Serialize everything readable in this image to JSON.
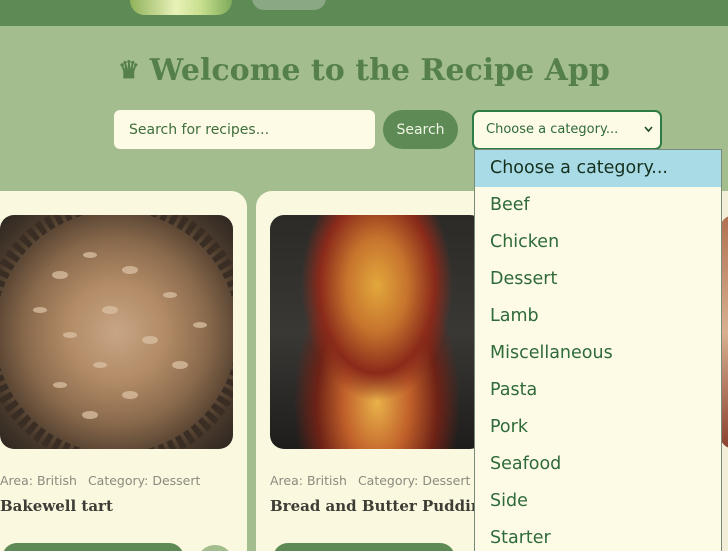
{
  "header": {
    "title": "Welcome to the Recipe App",
    "hat_icon": "♛"
  },
  "search": {
    "placeholder": "Search for recipes...",
    "button_label": "Search"
  },
  "category_select": {
    "selected": "Choose a category...",
    "chevron": "⌵",
    "options": [
      "Choose a category...",
      "Beef",
      "Chicken",
      "Dessert",
      "Lamb",
      "Miscellaneous",
      "Pasta",
      "Pork",
      "Seafood",
      "Side",
      "Starter"
    ]
  },
  "recipes": [
    {
      "area": "Area: British",
      "category": "Category: Dessert",
      "name": "Bakewell tart"
    },
    {
      "area": "Area: British",
      "category": "Category: Dessert",
      "name": "Bread and Butter Pudding"
    }
  ],
  "colors": {
    "background": "#a3bd8e",
    "accent": "#5e8a55",
    "card": "#fbf8e0",
    "selected_option": "#a8dbe6"
  }
}
